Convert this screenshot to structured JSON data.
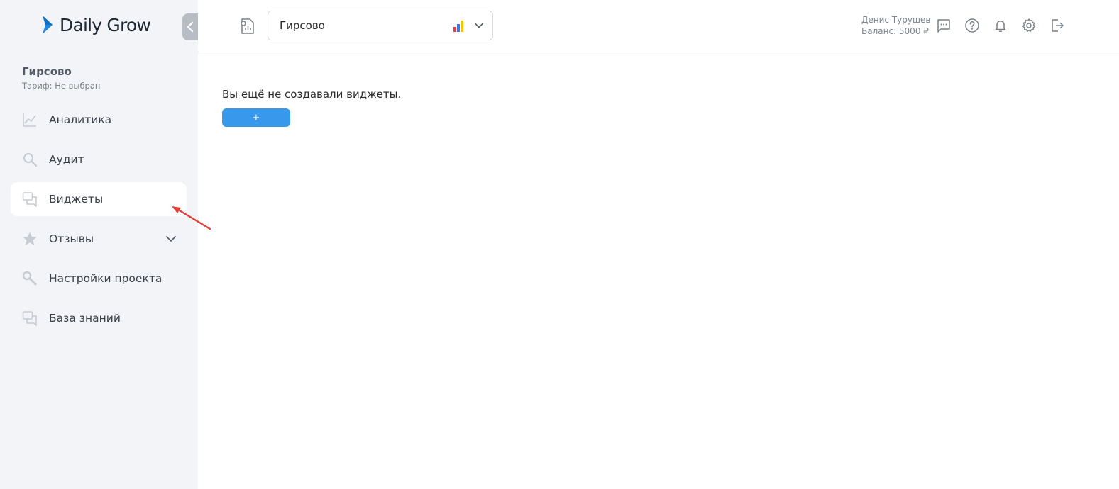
{
  "brand": {
    "name": "Daily Grow",
    "accent": "#3898ec"
  },
  "project": {
    "name": "Гирсово",
    "tariff": "Тариф: Не выбран"
  },
  "nav": {
    "items": [
      {
        "label": "Аналитика",
        "icon": "chart-icon"
      },
      {
        "label": "Аудит",
        "icon": "search-icon"
      },
      {
        "label": "Виджеты",
        "icon": "chat-bubbles-icon",
        "active": true
      },
      {
        "label": "Отзывы",
        "icon": "star-icon",
        "expandable": true
      },
      {
        "label": "Настройки проекта",
        "icon": "wrench-icon"
      },
      {
        "label": "База знаний",
        "icon": "chat-bubbles-icon"
      }
    ]
  },
  "topbar": {
    "project_select": {
      "value": "Гирсово"
    },
    "user": {
      "name": "Денис Турушев",
      "balance": "Баланс: 5000 ₽"
    },
    "icons": [
      "message-icon",
      "help-icon",
      "bell-icon",
      "settings-icon",
      "logout-icon"
    ]
  },
  "main": {
    "empty_text": "Вы ещё не создавали виджеты.",
    "add_button": "+"
  }
}
